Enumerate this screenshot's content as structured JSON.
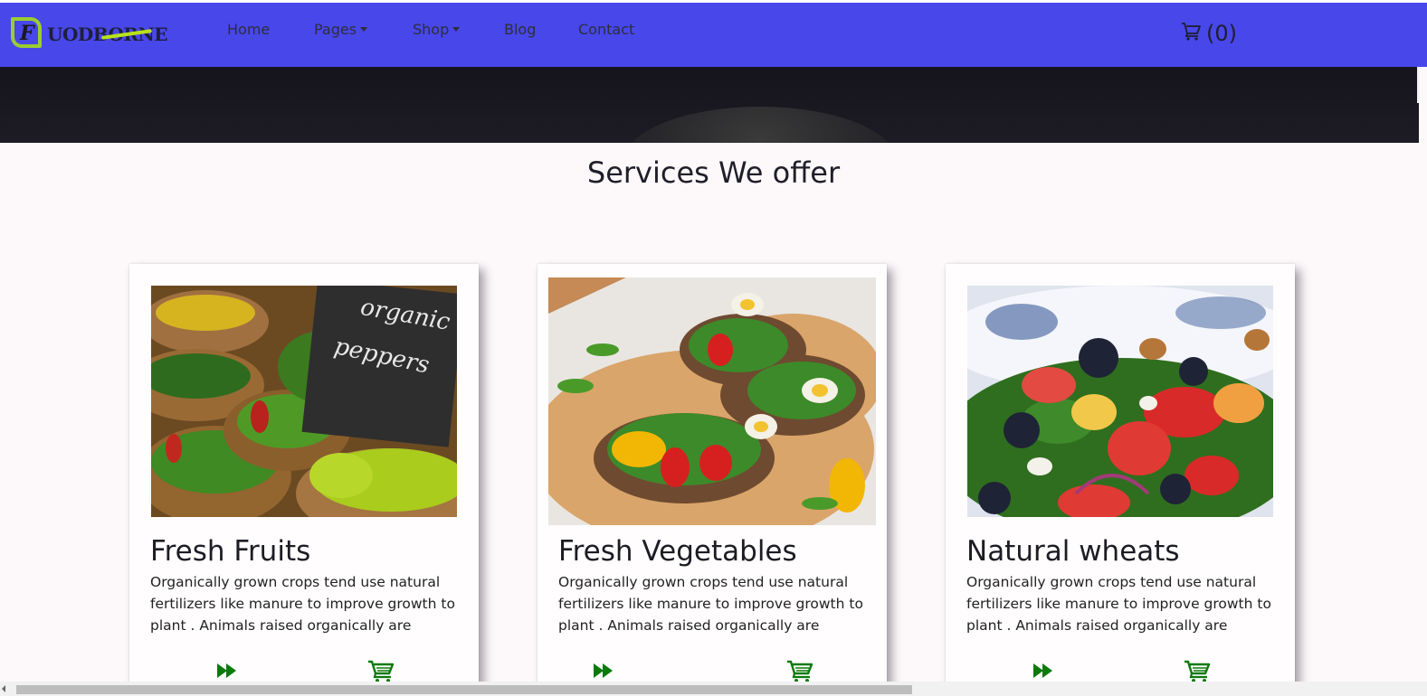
{
  "brand": {
    "logo_letter": "F",
    "logo_text": "UODBORNE",
    "colors": {
      "nav_bg": "#4747ea",
      "logo_green": "#9acd32",
      "icon_green": "#0b7a0b"
    }
  },
  "nav": {
    "links": [
      {
        "label": "Home",
        "dropdown": false
      },
      {
        "label": "Pages",
        "dropdown": true
      },
      {
        "label": "Shop",
        "dropdown": true
      },
      {
        "label": "Blog",
        "dropdown": false
      },
      {
        "label": "Contact",
        "dropdown": false
      }
    ],
    "cart_icon": "cart-icon",
    "cart_count": "(0)"
  },
  "services": {
    "title": "Services We offer",
    "cards": [
      {
        "title": "Fresh Fruits",
        "text": "Organically grown crops tend use natural fertilizers like manure to improve growth to plant . Animals raised organically are",
        "image": "organic peppers baskets with chalkboard sign",
        "image_sign_text": "organic peppers",
        "more_icon": "fast-forward-icon",
        "cart_icon": "cart-icon"
      },
      {
        "title": "Fresh Vegetables",
        "text": "Organically grown crops tend use natural fertilizers like manure to improve growth to plant . Animals raised organically are",
        "image": "open sandwiches with vegetables and eggs",
        "more_icon": "fast-forward-icon",
        "cart_icon": "cart-icon"
      },
      {
        "title": "Natural wheats",
        "text": "Organically grown crops tend use natural fertilizers like manure to improve growth to plant . Animals raised organically are",
        "image": "fruit salad with strawberries and blueberries",
        "more_icon": "fast-forward-icon",
        "cart_icon": "cart-icon"
      }
    ]
  }
}
